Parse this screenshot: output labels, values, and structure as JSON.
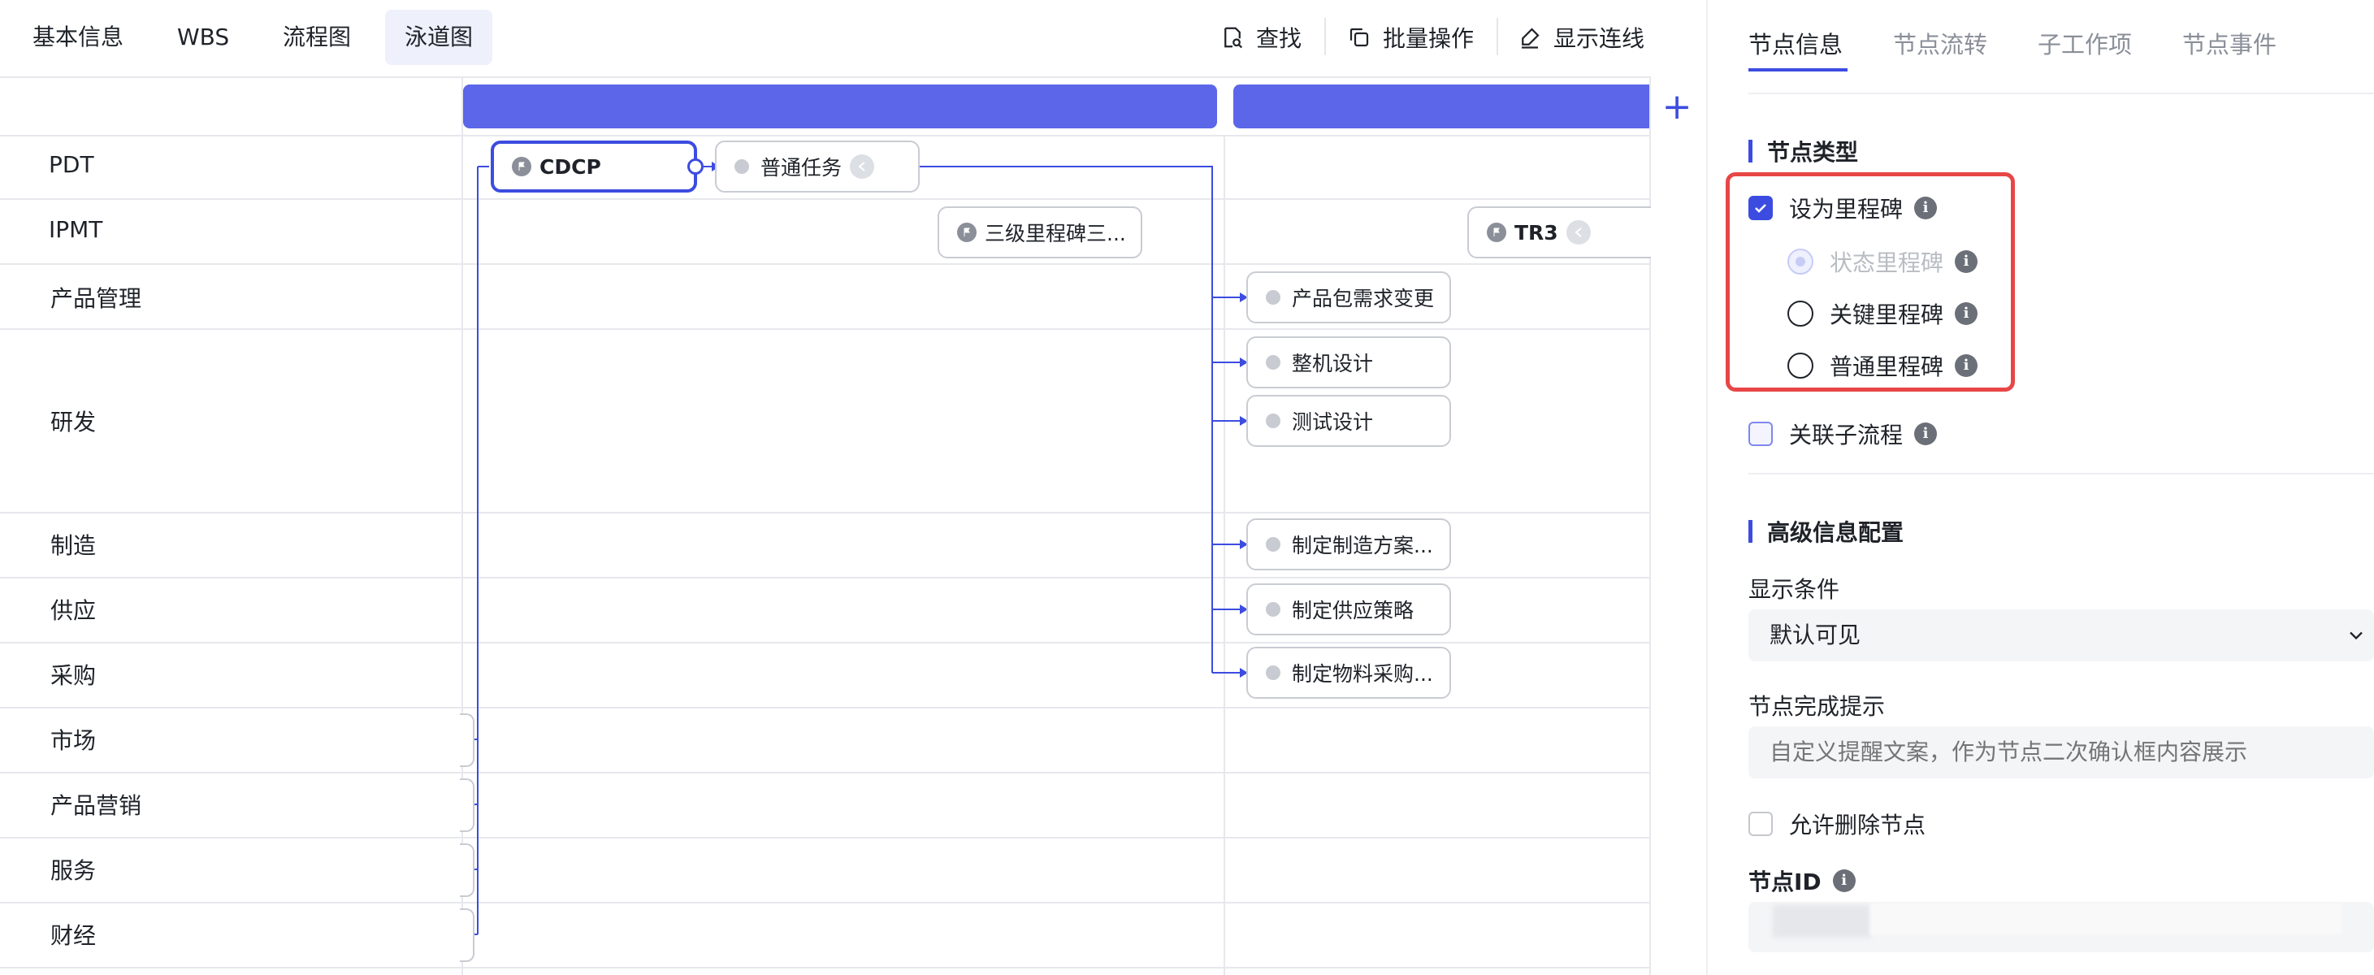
{
  "top_tabs": [
    {
      "label": "基本信息"
    },
    {
      "label": "WBS"
    },
    {
      "label": "流程图"
    },
    {
      "label": "泳道图",
      "active": true
    }
  ],
  "toolbar": {
    "find_label": "查找",
    "batch_label": "批量操作",
    "show_lines_label": "显示连线"
  },
  "lanes": [
    {
      "label": "PDT"
    },
    {
      "label": "IPMT"
    },
    {
      "label": "产品管理"
    },
    {
      "label": "研发"
    },
    {
      "label": "制造"
    },
    {
      "label": "供应"
    },
    {
      "label": "采购"
    },
    {
      "label": "市场"
    },
    {
      "label": "产品营销"
    },
    {
      "label": "服务"
    },
    {
      "label": "财经"
    }
  ],
  "nodes": {
    "cdcp": "CDCP",
    "normal_task": "普通任务",
    "third_level": "三级里程碑三...",
    "tr3": "TR3",
    "pkg_change": "产品包需求变更",
    "machine_design": "整机设计",
    "test_design": "测试设计",
    "mfg_plan": "制定制造方案...",
    "supply_strategy": "制定供应策略",
    "material_purchase": "制定物料采购..."
  },
  "add_phase_label": "+",
  "right_panel": {
    "tabs": [
      {
        "label": "节点信息",
        "active": true
      },
      {
        "label": "节点流转"
      },
      {
        "label": "子工作项"
      },
      {
        "label": "节点事件"
      }
    ],
    "node_type_title": "节点类型",
    "set_milestone": {
      "label": "设为里程碑",
      "checked": true
    },
    "milestone_options": [
      {
        "label": "状态里程碑",
        "disabled": true
      },
      {
        "label": "关键里程碑"
      },
      {
        "label": "普通里程碑"
      }
    ],
    "link_subprocess": {
      "label": "关联子流程",
      "checked": false
    },
    "advanced_title": "高级信息配置",
    "display_condition_label": "显示条件",
    "display_condition_value": "默认可见",
    "completion_hint_label": "节点完成提示",
    "completion_hint_placeholder": "自定义提醒文案，作为节点二次确认框内容展示",
    "allow_delete": {
      "label": "允许删除节点",
      "checked": false
    },
    "node_id_label": "节点ID",
    "info_icon_glyph": "i"
  },
  "colors": {
    "accent": "#3c4ce0",
    "phase_bar": "#5b66e8",
    "highlight": "#e84646"
  }
}
